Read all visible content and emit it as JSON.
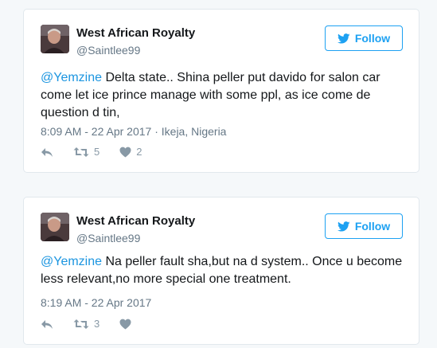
{
  "colors": {
    "link": "#1b95e0",
    "follow": "#1da1f2",
    "muted": "#657786",
    "icon": "#8899a6"
  },
  "tweets": [
    {
      "author": {
        "name": "West African Royalty",
        "handle": "@Saintlee99"
      },
      "follow_label": "Follow",
      "mention": "@Yemzine",
      "body": " Delta state.. Shina peller put davido for salon car come let ice prince manage with some ppl, as ice come de question d tin,",
      "time": "8:09 AM - 22 Apr 2017",
      "location": " · Ikeja, Nigeria",
      "retweets": "5",
      "likes": "2"
    },
    {
      "author": {
        "name": "West African Royalty",
        "handle": "@Saintlee99"
      },
      "follow_label": "Follow",
      "mention": "@Yemzine",
      "body": " Na peller fault sha,but na d system.. Once u become less relevant,no more special one treatment.",
      "time": "8:19 AM - 22 Apr 2017",
      "retweets": "3",
      "likes": ""
    }
  ]
}
